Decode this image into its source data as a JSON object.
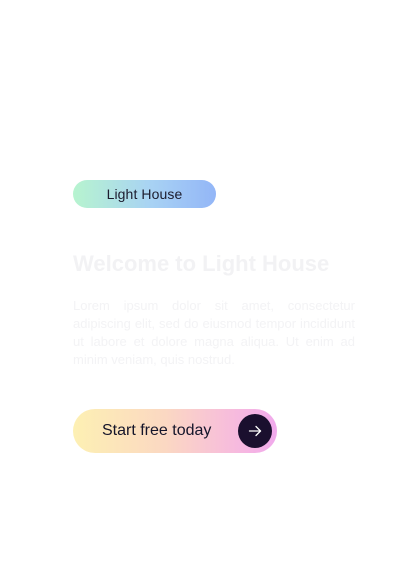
{
  "hero": {
    "badge_label": "Light House",
    "title": "Welcome to Light House",
    "description": "Lorem ipsum dolor sit amet, consectetur adipiscing elit, sed do eiusmod tempor incididunt ut labore et dolore magna aliqua. Ut enim ad minim veniam, quis nostrud.",
    "cta_label": "Start free today",
    "cta_icon": "arrow-right-icon"
  },
  "colors": {
    "badge_gradient": [
      "#b7f4cf",
      "#93b6f7"
    ],
    "cta_gradient": [
      "#fdf0b3",
      "#f0a9ec"
    ],
    "cta_icon_background": "#1a0f2e",
    "text_dark": "#15152a"
  }
}
